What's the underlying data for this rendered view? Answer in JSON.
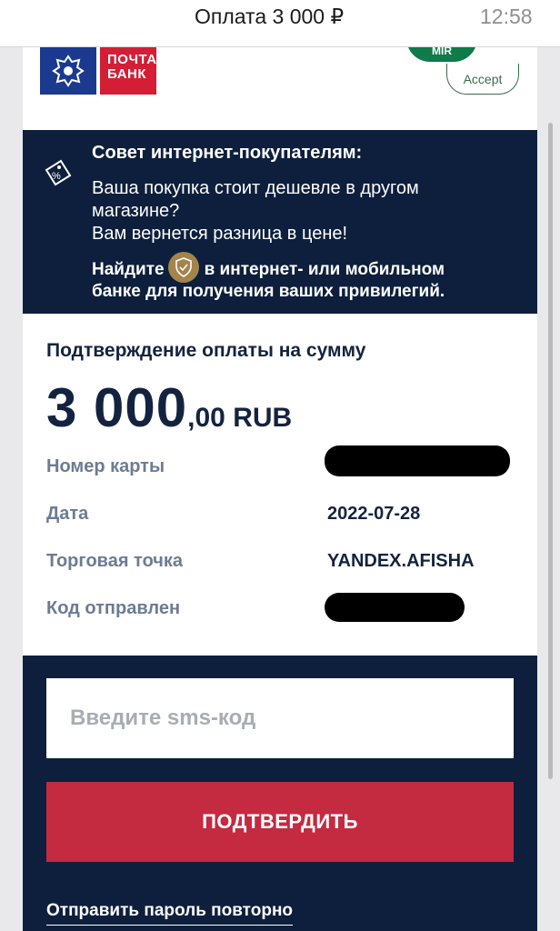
{
  "topbar": {
    "title": "Оплата 3 000 ₽",
    "time": "12:58"
  },
  "logo": {
    "line1": "ПОЧТА",
    "line2": "БАНК"
  },
  "badges": {
    "mir": "MIR",
    "accept": "Accept"
  },
  "tip": {
    "title": "Совет интернет-покупателям:",
    "line1": "Ваша покупка стоит дешевле в другом",
    "line2": "магазине?",
    "line3": "Вам вернется разница в цене!",
    "find_before": "Найдите",
    "find_after": "в интернет- или мобильном",
    "find_line2": "банке для получения ваших привилегий."
  },
  "confirm": {
    "title": "Подтверждение оплаты на сумму",
    "amount_int": "3 000",
    "amount_dec": ",00 RUB"
  },
  "details": {
    "card_label": "Номер карты",
    "date_label": "Дата",
    "date_value": "2022-07-28",
    "merchant_label": "Торговая точка",
    "merchant_value": "YANDEX.AFISHA",
    "code_label": "Код отправлен"
  },
  "form": {
    "sms_placeholder": "Введите sms-код",
    "confirm_label": "ПОДТВЕРДИТЬ",
    "resend_label": "Отправить пароль повторно"
  },
  "colors": {
    "navy": "#0d1f3c",
    "button_red": "#c42a40",
    "label_gray": "#6b7c93",
    "mir_green": "#0f7a4a"
  }
}
